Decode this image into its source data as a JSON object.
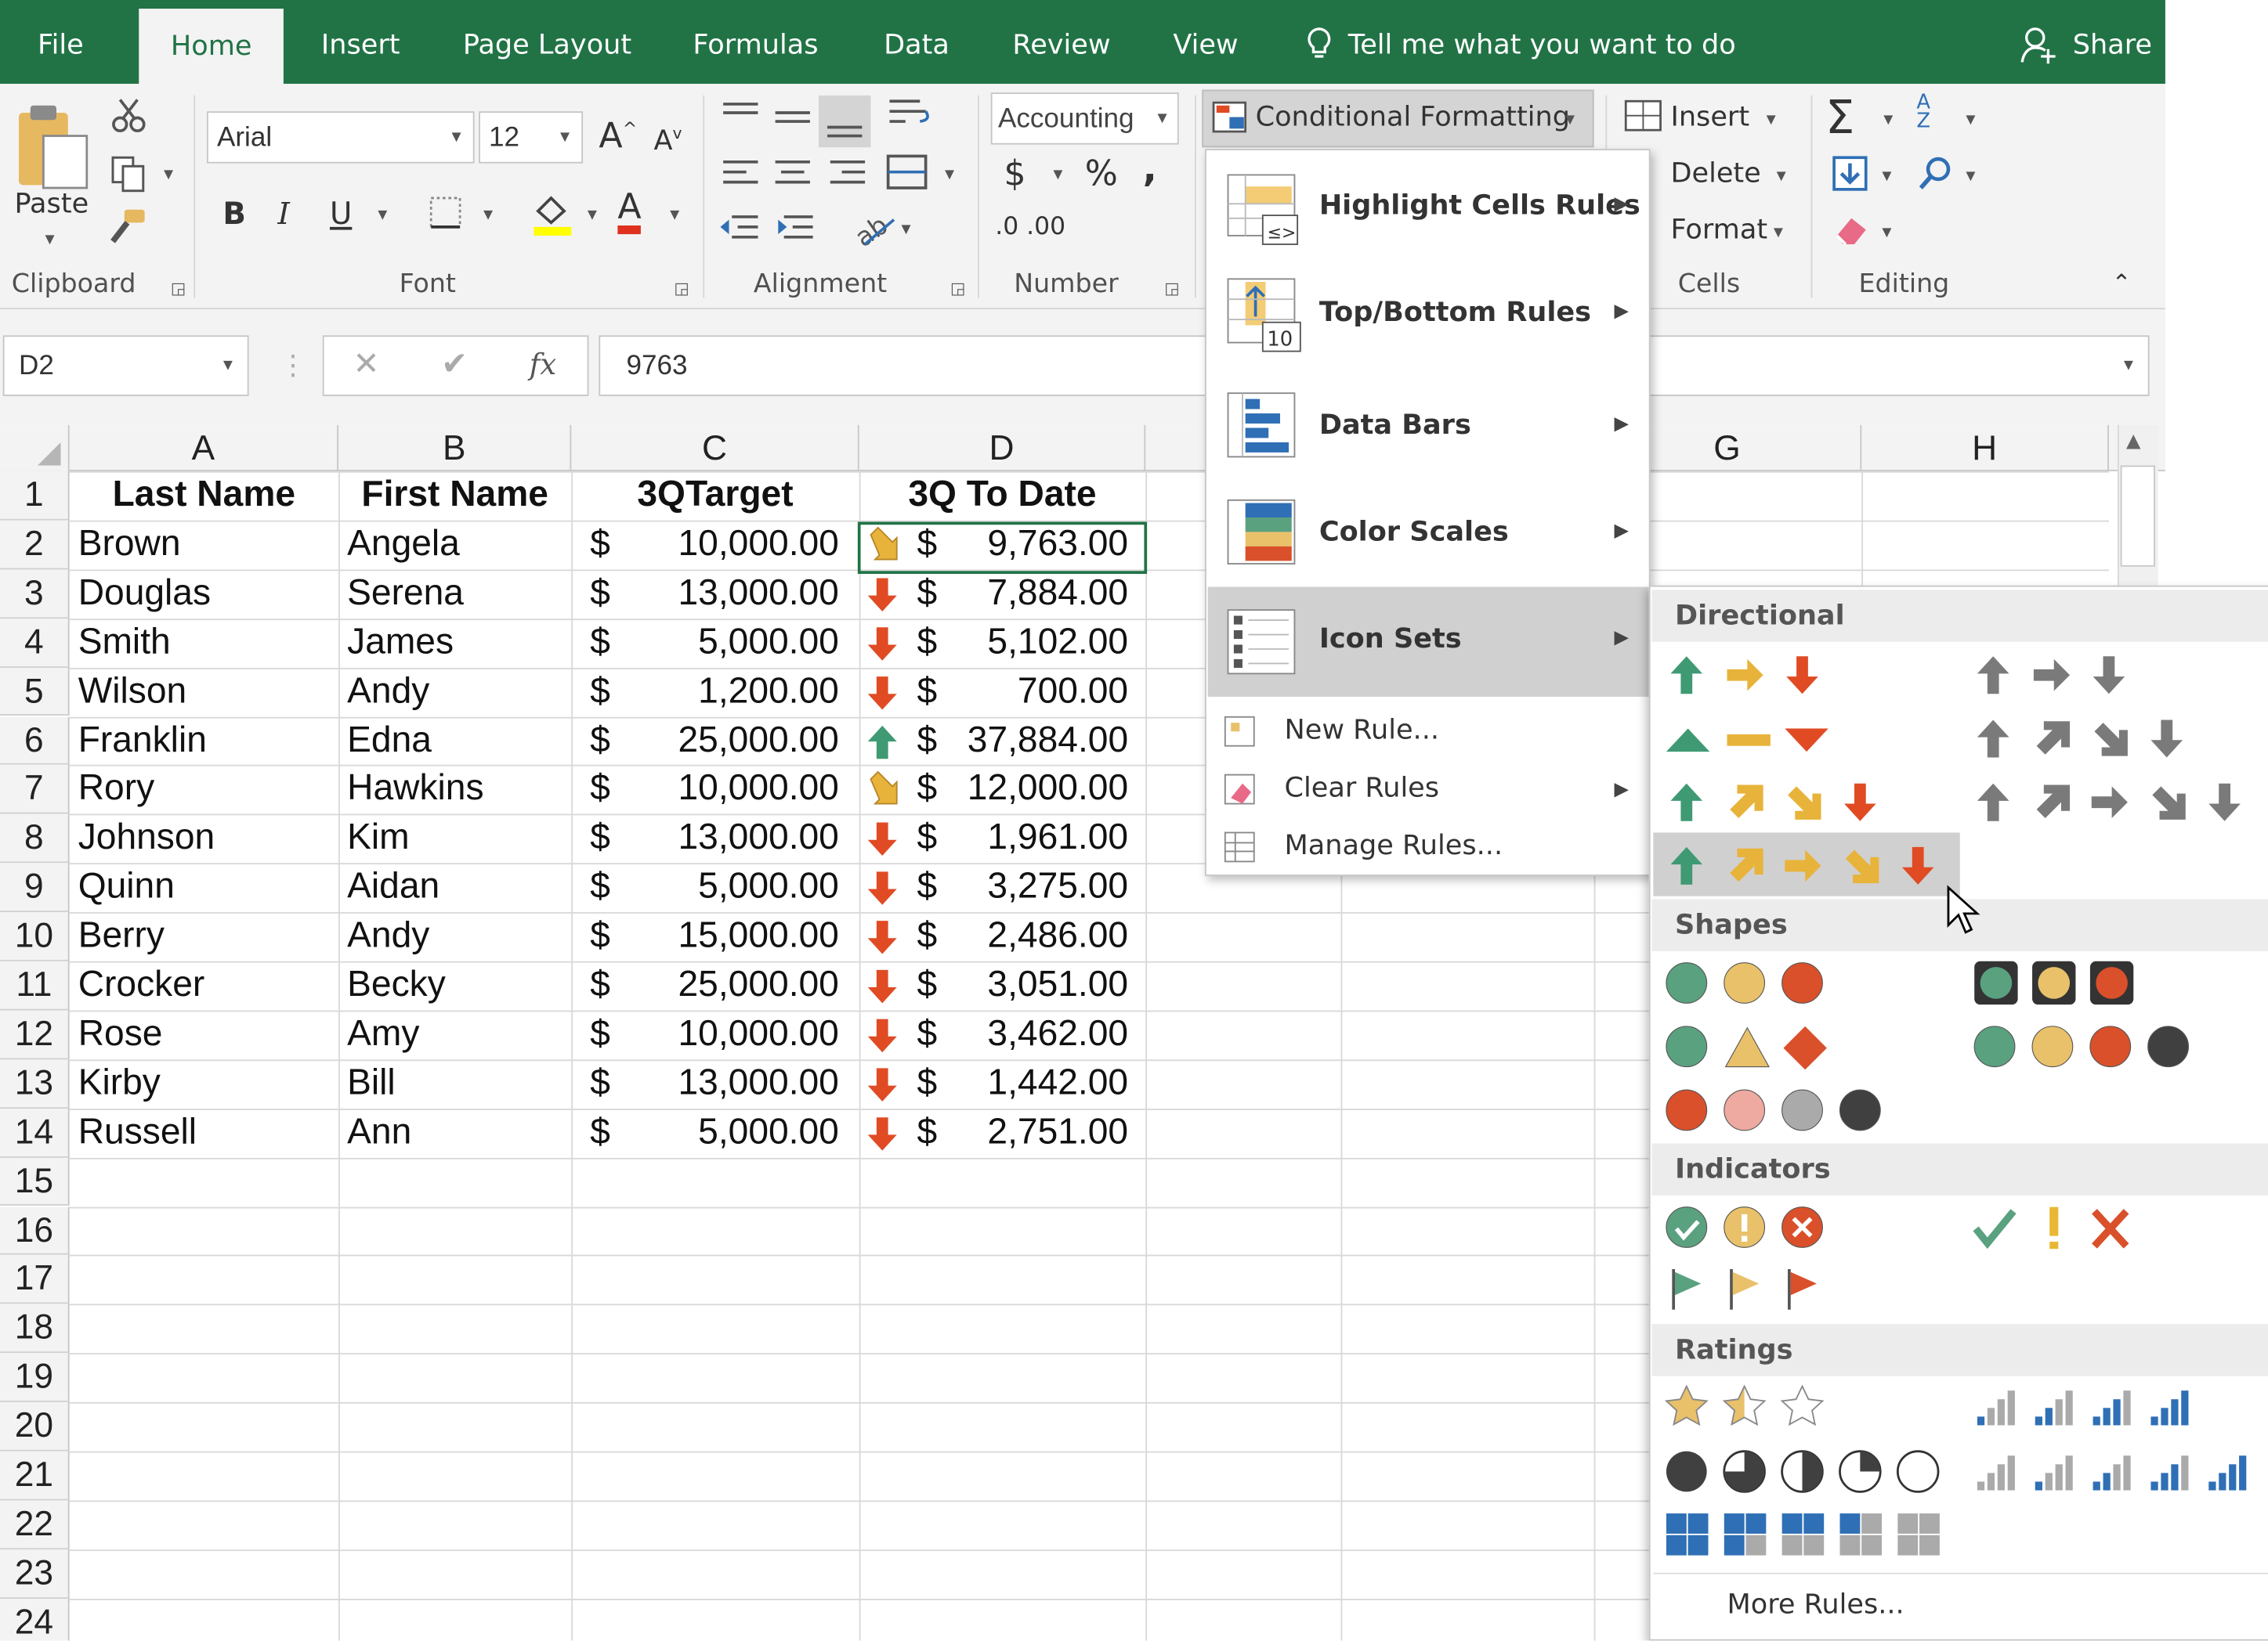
{
  "ribbon_tabs": [
    {
      "label": "File"
    },
    {
      "label": "Home"
    },
    {
      "label": "Insert"
    },
    {
      "label": "Page Layout"
    },
    {
      "label": "Formulas"
    },
    {
      "label": "Data"
    },
    {
      "label": "Review"
    },
    {
      "label": "View"
    }
  ],
  "tell_me": "Tell me what you want to do",
  "share": "Share",
  "clipboard": {
    "paste": "Paste",
    "group": "Clipboard"
  },
  "font": {
    "name": "Arial",
    "size": "12",
    "bold": "B",
    "italic": "I",
    "underline": "U",
    "group": "Font"
  },
  "alignment": {
    "group": "Alignment"
  },
  "number": {
    "format": "Accounting",
    "currency": "$",
    "percent": "%",
    "comma": ",",
    "inc_dec": ".0 .00",
    "group": "Number"
  },
  "styles": {
    "conditional_formatting": "Conditional Formatting"
  },
  "cells": {
    "insert": "Insert",
    "delete": "Delete",
    "format": "Format",
    "group": "Cells"
  },
  "editing": {
    "sort": "A Z",
    "group": "Editing"
  },
  "formula_bar": {
    "name_box": "D2",
    "fx": "fx",
    "value": "9763"
  },
  "columns": [
    "A",
    "B",
    "C",
    "D",
    "G",
    "H"
  ],
  "rows": [
    "1",
    "2",
    "3",
    "4",
    "5",
    "6",
    "7",
    "8",
    "9",
    "10",
    "11",
    "12",
    "13",
    "14",
    "15",
    "16",
    "17",
    "18",
    "19",
    "20",
    "21",
    "22",
    "23",
    "24"
  ],
  "headers": {
    "last": "Last Name",
    "first": "First Name",
    "target": "3QTarget",
    "todate": "3Q To Date"
  },
  "data": [
    {
      "last": "Brown",
      "first": "Angela",
      "target": "10,000.00",
      "todate": "9,763.00",
      "icon": "arrow-down-right-yellow"
    },
    {
      "last": "Douglas",
      "first": "Serena",
      "target": "13,000.00",
      "todate": "7,884.00",
      "icon": "arrow-down-red"
    },
    {
      "last": "Smith",
      "first": "James",
      "target": "5,000.00",
      "todate": "5,102.00",
      "icon": "arrow-down-red"
    },
    {
      "last": "Wilson",
      "first": "Andy",
      "target": "1,200.00",
      "todate": "700.00",
      "icon": "arrow-down-red"
    },
    {
      "last": "Franklin",
      "first": "Edna",
      "target": "25,000.00",
      "todate": "37,884.00",
      "icon": "arrow-up-green"
    },
    {
      "last": "Rory",
      "first": "Hawkins",
      "target": "10,000.00",
      "todate": "12,000.00",
      "icon": "arrow-down-right-yellow"
    },
    {
      "last": "Johnson",
      "first": "Kim",
      "target": "13,000.00",
      "todate": "1,961.00",
      "icon": "arrow-down-red"
    },
    {
      "last": "Quinn",
      "first": "Aidan",
      "target": "5,000.00",
      "todate": "3,275.00",
      "icon": "arrow-down-red"
    },
    {
      "last": "Berry",
      "first": "Andy",
      "target": "15,000.00",
      "todate": "2,486.00",
      "icon": "arrow-down-red"
    },
    {
      "last": "Crocker",
      "first": "Becky",
      "target": "25,000.00",
      "todate": "3,051.00",
      "icon": "arrow-down-red"
    },
    {
      "last": "Rose",
      "first": "Amy",
      "target": "10,000.00",
      "todate": "3,462.00",
      "icon": "arrow-down-red"
    },
    {
      "last": "Kirby",
      "first": "Bill",
      "target": "13,000.00",
      "todate": "1,442.00",
      "icon": "arrow-down-red"
    },
    {
      "last": "Russell",
      "first": "Ann",
      "target": "5,000.00",
      "todate": "2,751.00",
      "icon": "arrow-down-red"
    }
  ],
  "currency_symbol": "$",
  "cf_menu": {
    "items": [
      {
        "label": "Highlight Cells Rules"
      },
      {
        "label": "Top/Bottom Rules"
      },
      {
        "label": "Data Bars"
      },
      {
        "label": "Color Scales"
      },
      {
        "label": "Icon Sets"
      }
    ],
    "actions": [
      {
        "label": "New Rule..."
      },
      {
        "label": "Clear Rules"
      },
      {
        "label": "Manage Rules..."
      }
    ],
    "top10_badge": "10",
    "highlight_badge": "≤>"
  },
  "icon_sets": {
    "sections": [
      "Directional",
      "Shapes",
      "Indicators",
      "Ratings"
    ],
    "more_rules": "More Rules..."
  },
  "colors": {
    "excel_green": "#217346",
    "arrow_green": "#3f9a73",
    "arrow_yellow": "#e8b33a",
    "arrow_red": "#e04b24",
    "gray": "#7a7a7a",
    "shape_green": "#5aa17f",
    "shape_yellow": "#e9c16a",
    "shape_red": "#d9502b",
    "bar_blue": "#2f6fb5"
  }
}
